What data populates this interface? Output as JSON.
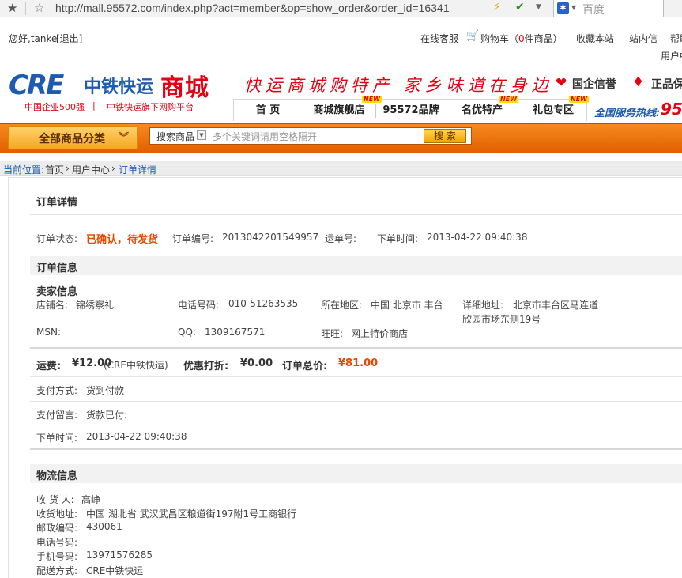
{
  "browser": {
    "url": "http://mall.95572.com/index.php?act=member&op=show_order&order_id=16341",
    "search_placeholder": "百度"
  },
  "toplinks": {
    "greeting": "您好,tanke",
    "logout": "[退出]",
    "online_service": "在线客服",
    "cart_prefix": "购物车（",
    "cart_count": "0",
    "cart_suffix": "件商品）",
    "bookmark": "收藏本站",
    "messages": "站内信",
    "help": "帮助"
  },
  "header": {
    "user_center_partial": "用户中",
    "logo_cre": "CRE",
    "logo_zh": "中铁快运",
    "logo_shop": "商城",
    "logo_sub1": "中国企业500强",
    "logo_sub_sep": "|",
    "logo_sub2": "中铁快运旗下网购平台",
    "slogan": "快运商城购特产 家乡味道在身边",
    "badge_guoqi": "国企信誉",
    "badge_zhengpin": "正品保"
  },
  "nav": {
    "tabs": [
      "首 页",
      "商城旗舰店",
      "95572品牌",
      "名优特产",
      "礼包专区"
    ],
    "new_badge": "NEW",
    "hotline_label": "全国服务热线:",
    "hotline_num": "95"
  },
  "searchbar": {
    "category_button": "全部商品分类",
    "select_value": "搜索商品",
    "placeholder": "多个关键词请用空格隔开",
    "search_button": "搜 索"
  },
  "breadcrumb": {
    "label": "当前位置:",
    "home": "首页",
    "sep": "›",
    "user_center": "用户中心",
    "current": "订单详情"
  },
  "order": {
    "title": "订单详情",
    "status_label": "订单状态:",
    "status_value": "已确认，待发货",
    "number_label": "订单编号:",
    "number_value": "2013042201549957",
    "waybill_label": "运单号:",
    "time_label": "下单时间:",
    "time_value": "2013-04-22 09:40:38"
  },
  "order_info": {
    "title": "订单信息",
    "seller_title": "卖家信息",
    "shop_label": "店铺名:",
    "shop_value": "锦绣察礼",
    "phone_label": "电话号码:",
    "phone_value": "010-51263535",
    "region_label": "所在地区:",
    "region_value": "中国 北京市 丰台",
    "address_label": "详细地址:",
    "address_line1": "北京市丰台区马连道",
    "address_line2": "欣园市场东侧19号",
    "msn_label": "MSN:",
    "qq_label": "QQ:",
    "qq_value": "1309167571",
    "wangwang_label": "旺旺:",
    "wangwang_value": "网上特价商店"
  },
  "totals": {
    "shipping_label": "运费:",
    "shipping_value": "¥12.00",
    "shipping_carrier": "(CRE中铁快运)",
    "discount_label": "优惠打折:",
    "discount_value": "¥0.00",
    "total_label": "订单总价:",
    "total_value": "¥81.00"
  },
  "payment": {
    "method_label": "支付方式:",
    "method_value": "货到付款",
    "note_label": "支付留言:",
    "note_value": "货款已付:",
    "time_label": "下单时间:",
    "time_value": "2013-04-22 09:40:38"
  },
  "logistics": {
    "title": "物流信息",
    "receiver_label": "收 货 人:",
    "receiver_value": "高峥",
    "address_label": "收货地址:",
    "address_value": "中国 湖北省 武汉武昌区粮道街197附1号工商银行",
    "postcode_label": "邮政编码:",
    "postcode_value": "430061",
    "phone_label": "电话号码:",
    "mobile_label": "手机号码:",
    "mobile_value": "13971576285",
    "delivery_label": "配送方式:",
    "delivery_value": "CRE中铁快运"
  },
  "colors": {
    "brand_blue": "#1e5bb0",
    "brand_red": "#e60012",
    "orange_bar": "#f07d14",
    "status_orange": "#e64a00"
  }
}
